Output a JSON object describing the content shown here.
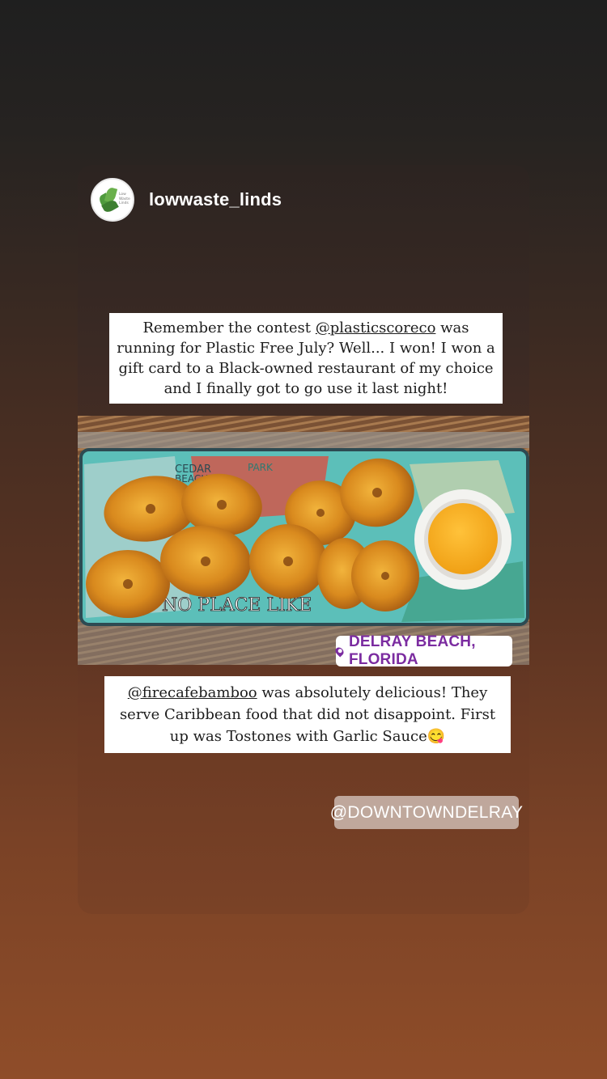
{
  "story": {
    "username": "lowwaste_linds",
    "avatar_text": "Low Waste Linds"
  },
  "caption1": {
    "line1_prefix": "Remember the contest ",
    "mention": "@plasticscoreco",
    "line1_suffix": " was",
    "rest": "running for Plastic Free July? Well... I won! I won a gift card to a Black-owned restaurant of my choice and I finally got to go use it last night!"
  },
  "photo": {
    "plate_text": "NO PLACE LIKE",
    "plate_top_text": "CEDAR BEACH",
    "plate_park_text": "PARK"
  },
  "location_sticker": {
    "label": "DELRAY BEACH, FLORIDA",
    "icon": "location-pin-icon",
    "color": "#7b2ca0"
  },
  "caption2": {
    "mention": "@firecafebamboo",
    "text": " was absolutely delicious! They serve Caribbean food that did not disappoint. First up was Tostones with Garlic Sauce",
    "emoji": "😋"
  },
  "mention_sticker": {
    "label": "@DOWNTOWNDELRAY"
  }
}
